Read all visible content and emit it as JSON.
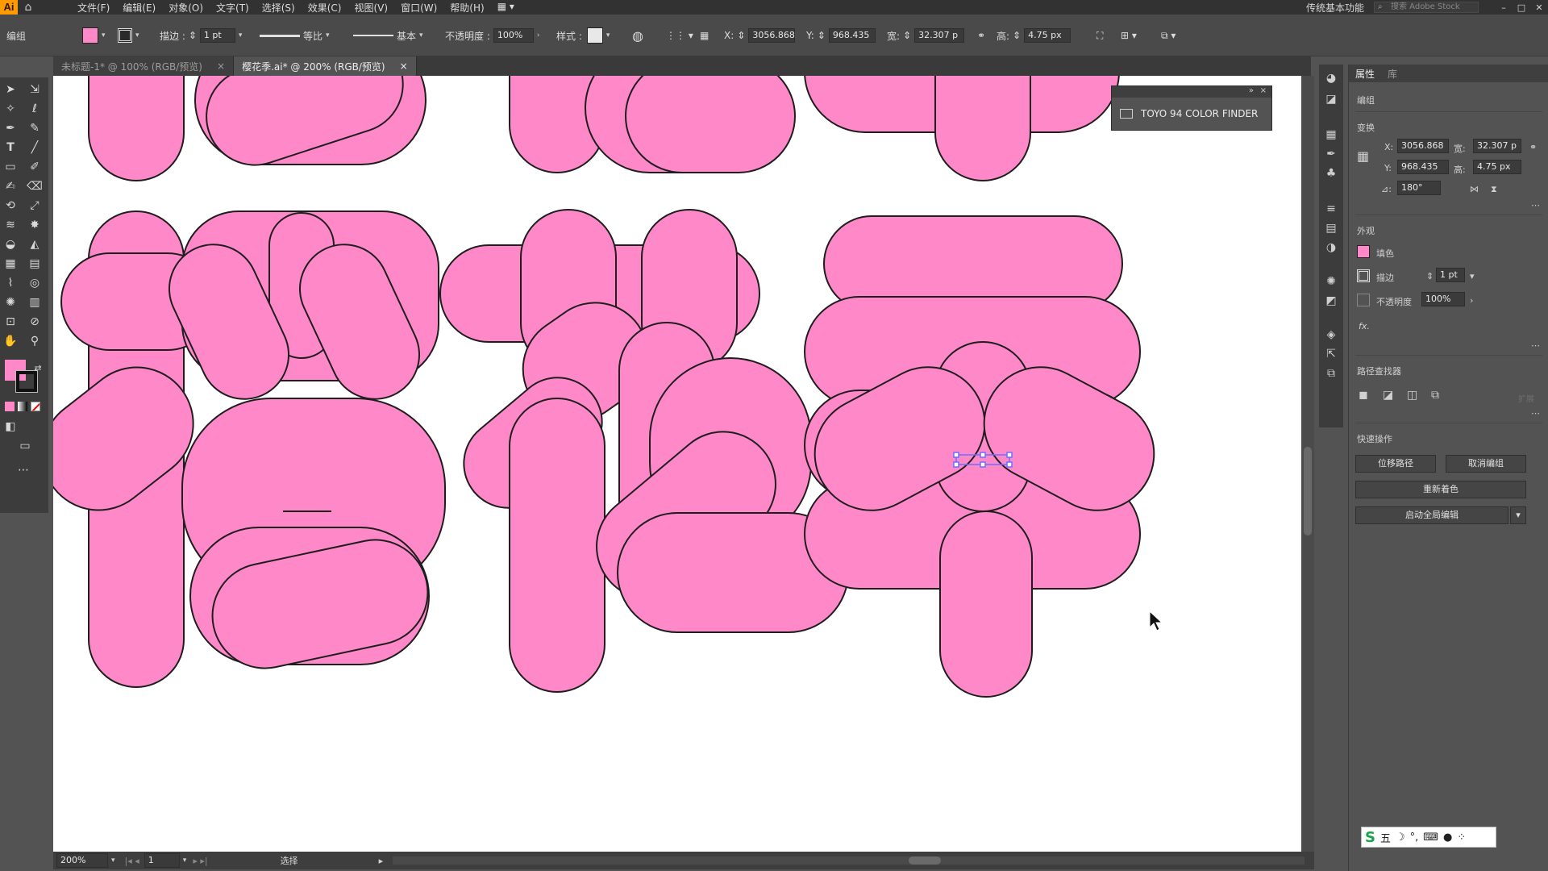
{
  "app": {
    "logo": "Ai",
    "home_icon": "home-icon"
  },
  "menu": [
    "文件(F)",
    "编辑(E)",
    "对象(O)",
    "文字(T)",
    "选择(S)",
    "效果(C)",
    "视图(V)",
    "窗口(W)",
    "帮助(H)"
  ],
  "menu_right": {
    "workspace": "传统基本功能",
    "search_placeholder": "搜索 Adobe Stock"
  },
  "control": {
    "mode": "编组",
    "fill_color": "#ff88c8",
    "stroke_label": "描边 :",
    "stroke_value": "1 pt",
    "profile_label": "等比",
    "brush_label": "基本",
    "opacity_label": "不透明度 :",
    "opacity_value": "100%",
    "style_label": "样式 :",
    "x_label": "X:",
    "x_value": "3056.868",
    "y_label": "Y:",
    "y_value": "968.435",
    "w_label": "宽:",
    "w_value": "32.307 p",
    "h_label": "高:",
    "h_value": "4.75 px"
  },
  "tabs": [
    {
      "label": "未标题-1* @ 100% (RGB/预览)",
      "close": "×"
    },
    {
      "label": "樱花季.ai* @ 200% (RGB/预览)",
      "close": "×"
    }
  ],
  "artwork": {
    "fill": "#ff88c8",
    "stroke": "#1e1e1e"
  },
  "color_finder": {
    "title": "TOYO 94 COLOR FINDER",
    "collapse": "»",
    "close": "×"
  },
  "properties": {
    "tabs": [
      "属性",
      "库"
    ],
    "group_label": "编组",
    "transform_label": "变换",
    "x_label": "X:",
    "x_value": "3056.868",
    "y_label": "Y:",
    "y_value": "968.435",
    "w_label": "宽:",
    "w_value": "32.307 p",
    "h_label": "高:",
    "h_value": "4.75 px",
    "angle_label": "⊿:",
    "angle_value": "180°",
    "appearance_label": "外观",
    "fill_label": "填色",
    "stroke_label": "描边",
    "stroke_value": "1 pt",
    "opacity_label": "不透明度",
    "opacity_value": "100%",
    "fx_label": "fx.",
    "pathfinder_label": "路径查找器",
    "expand_label": "扩展",
    "quick_actions_label": "快速操作",
    "offset_path": "位移路径",
    "ungroup": "取消编组",
    "recolor": "重新着色",
    "global_edit": "启动全局编辑"
  },
  "status": {
    "zoom": "200%",
    "artboard": "1",
    "tool": "选择"
  },
  "ime": {
    "logo": "S",
    "mode": "五",
    "icons": [
      "moon-icon",
      "punct-icon",
      "keyboard-icon",
      "user-icon",
      "grid-icon"
    ]
  }
}
